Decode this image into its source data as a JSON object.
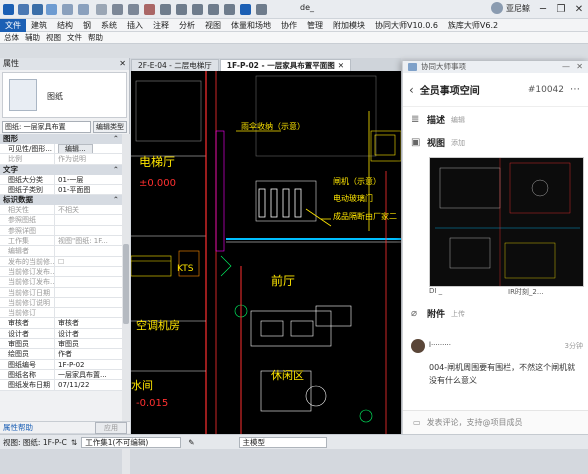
{
  "titlebar": {
    "workset_value": "de_",
    "user_name": "亚尼鲸",
    "minimize": "─",
    "restore": "❐",
    "close": "✕"
  },
  "ribbon": {
    "tabs": [
      "文件",
      "建筑",
      "结构",
      "钢",
      "系统",
      "插入",
      "注释",
      "分析",
      "视图",
      "体量和场地",
      "协作",
      "管理",
      "附加模块",
      "协同大师V10.0.6",
      "族库大师V6.2"
    ]
  },
  "menubar": {
    "items": [
      "总体",
      "辅助",
      "视图",
      "文件",
      "帮助"
    ]
  },
  "properties": {
    "title": "属性",
    "close": "✕",
    "type_name": "图纸",
    "selector": "图纸: 一层家具布置",
    "edit_type": "编辑类型",
    "groups": [
      {
        "name": "图形",
        "rows": [
          {
            "k": "可见性/图形...",
            "v": "编辑...",
            "button": true
          },
          {
            "k": "比例",
            "v": "作为说明",
            "dim": true
          }
        ]
      },
      {
        "name": "文字",
        "rows": [
          {
            "k": "图纸大分类",
            "v": "01-一层"
          },
          {
            "k": "图纸子类别",
            "v": "01-平面图"
          }
        ]
      },
      {
        "name": "标识数据",
        "rows": [
          {
            "k": "相关性",
            "v": "不相关",
            "dim": true
          },
          {
            "k": "参照图纸",
            "v": "",
            "dim": true
          },
          {
            "k": "参照详图",
            "v": "",
            "dim": true
          },
          {
            "k": "工作集",
            "v": "视图\"图纸: 1F...",
            "dim": true
          },
          {
            "k": "编辑者",
            "v": "",
            "dim": true
          },
          {
            "k": "发布的当前修...",
            "v": "☐",
            "dim": true
          },
          {
            "k": "当前修订发布...",
            "v": "",
            "dim": true
          },
          {
            "k": "当前修订发布...",
            "v": "",
            "dim": true
          },
          {
            "k": "当前修订日期",
            "v": "",
            "dim": true
          },
          {
            "k": "当前修订说明",
            "v": "",
            "dim": true
          },
          {
            "k": "当前修订",
            "v": "",
            "dim": true
          },
          {
            "k": "审核者",
            "v": "审核者"
          },
          {
            "k": "设计者",
            "v": "设计者"
          },
          {
            "k": "审图员",
            "v": "审图员"
          },
          {
            "k": "绘图员",
            "v": "作者"
          },
          {
            "k": "图纸编号",
            "v": "1F-P-02"
          },
          {
            "k": "图纸名称",
            "v": "一层家具布置..."
          },
          {
            "k": "图纸发布日期",
            "v": "07/11/22"
          }
        ]
      }
    ],
    "help_link": "属性帮助",
    "apply_button": "应用"
  },
  "doc_tabs": [
    {
      "label": "2F-E-04 - 二层电梯厅",
      "active": false
    },
    {
      "label": "1F-P-02 - 一层家具布置平面图",
      "active": true
    }
  ],
  "drawing": {
    "labels": [
      "电梯厅",
      "雨伞收纳（示意）",
      "闸机（示意）",
      "电动玻璃门",
      "成品隔断由厂家二",
      "前厅",
      "空调机房",
      "休闲区",
      "KTS",
      "水间"
    ],
    "elevation_labels": [
      "±0.000",
      "-0.015"
    ]
  },
  "panel": {
    "window_title": "协同大师事项",
    "ctl_pin": "—",
    "ctl_close": "✕",
    "header_title": "全员事项空间",
    "issue_id": "#10042",
    "more": "⋯",
    "back": "‹",
    "description_label": "描述",
    "description_action": "编辑",
    "view_label": "视图",
    "view_action": "添加",
    "caption_left": "DI _",
    "caption_right": "IR时刻_2...",
    "attachment_label": "附件",
    "attachment_action": "上传",
    "comment": {
      "author": "l·········",
      "time": "3分钟",
      "body": "004-闸机周围要有围栏，不然这个闸机就没有什么意义"
    },
    "comment_placeholder": "发表评论，支持@项目成员"
  },
  "status": {
    "view_select": "视图: 图纸: 1F-P-C",
    "workset": "工作集1(不可编辑)",
    "model": "主模型"
  }
}
